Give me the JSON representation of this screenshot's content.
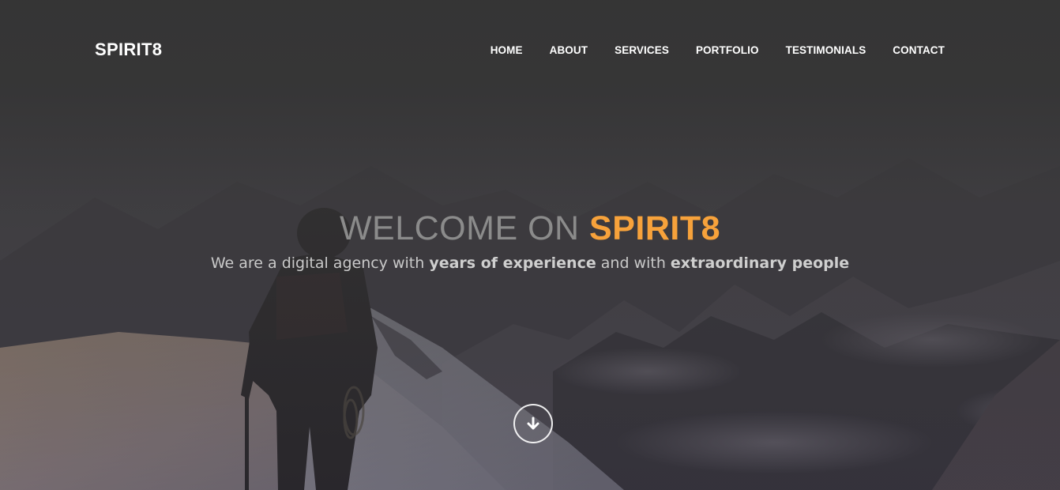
{
  "brand": {
    "name": "SPIRIT8"
  },
  "nav": {
    "items": [
      {
        "label": "HOME"
      },
      {
        "label": "ABOUT"
      },
      {
        "label": "SERVICES"
      },
      {
        "label": "PORTFOLIO"
      },
      {
        "label": "TESTIMONIALS"
      },
      {
        "label": "CONTACT"
      }
    ]
  },
  "hero": {
    "headline_prefix": "WELCOME ON ",
    "headline_accent": "SPIRIT8",
    "sub_part1": "We are a digital agency with ",
    "sub_bold1": "years of experience",
    "sub_part2": " and with ",
    "sub_bold2": "extraordinary people",
    "scroll_icon": "arrow-down-circle-icon"
  },
  "colors": {
    "accent": "#f7a23b",
    "overlay": "#343434",
    "text_light": "#ffffff"
  }
}
